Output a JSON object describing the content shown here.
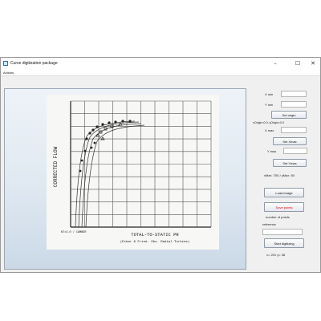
{
  "window": {
    "title": "Curve digitization package",
    "minimize_icon": "minimize-icon",
    "maximize_icon": "maximize-icon",
    "close_icon": "close-icon"
  },
  "menu": {
    "items": [
      {
        "label": "Actions"
      }
    ]
  },
  "image": {
    "y_label": "CORRECTED FLOW",
    "x_label": "TOTAL-TO-STATIC PR",
    "caption": "(Eckar & Fried. Obs. Radial Turbine)",
    "corner_text": "NT=4.0 / CAMBER"
  },
  "sidebar": {
    "xmin_label": "X min",
    "xmin_value": "",
    "ymin_label": "Y min",
    "ymin_value": "",
    "set_origin_label": "Set origin",
    "origin_note": "xOrigin=0.0; yOrigin=0.0",
    "xmax_label": "X max",
    "xmax_value": "",
    "set_xmax_label": "Set Xmax",
    "ymax_label": "Y max",
    "ymax_value": "",
    "set_ymax_label": "Set Ymax",
    "max_note": "xMax :750 / yMax :50",
    "load_image_label": "Load Image",
    "save_points_label": "Save points",
    "num_points_label": "number of points",
    "reference_label": "reference",
    "num_points_value": "",
    "start_digitizing_label": "Start digitizing",
    "status": "x= 201  y= 38"
  },
  "colors": {
    "accent": "#3a6ea5",
    "save_text": "#e00000"
  }
}
